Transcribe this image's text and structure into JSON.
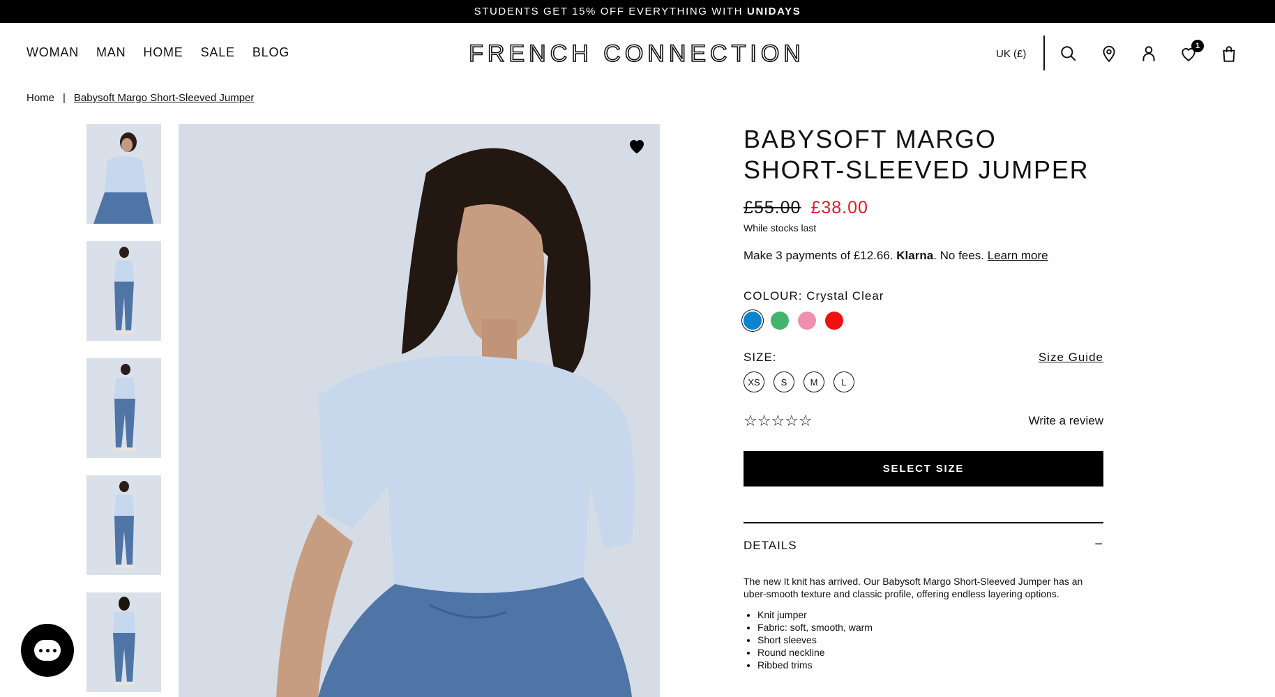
{
  "promo": {
    "text": "STUDENTS GET 15% OFF EVERYTHING WITH",
    "brand": "UNIDAYS"
  },
  "nav": {
    "items": [
      "WOMAN",
      "MAN",
      "HOME",
      "SALE",
      "BLOG"
    ]
  },
  "logo": {
    "text": "FRENCH CONNECTION"
  },
  "header": {
    "locale": "UK (£)",
    "wishlist_count": "1"
  },
  "breadcrumb": {
    "home": "Home",
    "separator": "|",
    "current": "Babysoft Margo Short-Sleeved Jumper"
  },
  "product": {
    "title": "BABYSOFT MARGO SHORT-SLEEVED JUMPER",
    "price_old": "£55.00",
    "price_new": "£38.00",
    "stock_note": "While stocks last",
    "klarna": {
      "prefix": "Make 3 payments of £12.66.",
      "brand": "Klarna",
      "suffix": ". No fees.",
      "link": "Learn more"
    },
    "colour_label": "COLOUR:",
    "colour_value": "Crystal Clear",
    "swatches": [
      "#0a84d0",
      "#44b36b",
      "#f090b0",
      "#f20f0f"
    ],
    "size_label": "SIZE:",
    "size_guide": "Size Guide",
    "sizes": [
      "XS",
      "S",
      "M",
      "L"
    ],
    "stars": "☆☆☆☆☆",
    "write_review": "Write a review",
    "cta": "SELECT SIZE",
    "details_title": "DETAILS",
    "details_toggle": "−",
    "details_text": "The new It knit has arrived. Our Babysoft Margo Short-Sleeved Jumper has an uber-smooth texture and classic profile, offering endless layering options.",
    "details_bullets": [
      "Knit jumper",
      "Fabric: soft, smooth, warm",
      "Short sleeves",
      "Round neckline",
      "Ribbed trims"
    ]
  },
  "colors": {
    "sale_red": "#e11b22",
    "primary": "#000000",
    "image_bg": "#d5dce5"
  },
  "icons": [
    "search-icon",
    "location-icon",
    "account-icon",
    "wishlist-icon",
    "bag-icon",
    "heart-icon",
    "chat-icon"
  ]
}
